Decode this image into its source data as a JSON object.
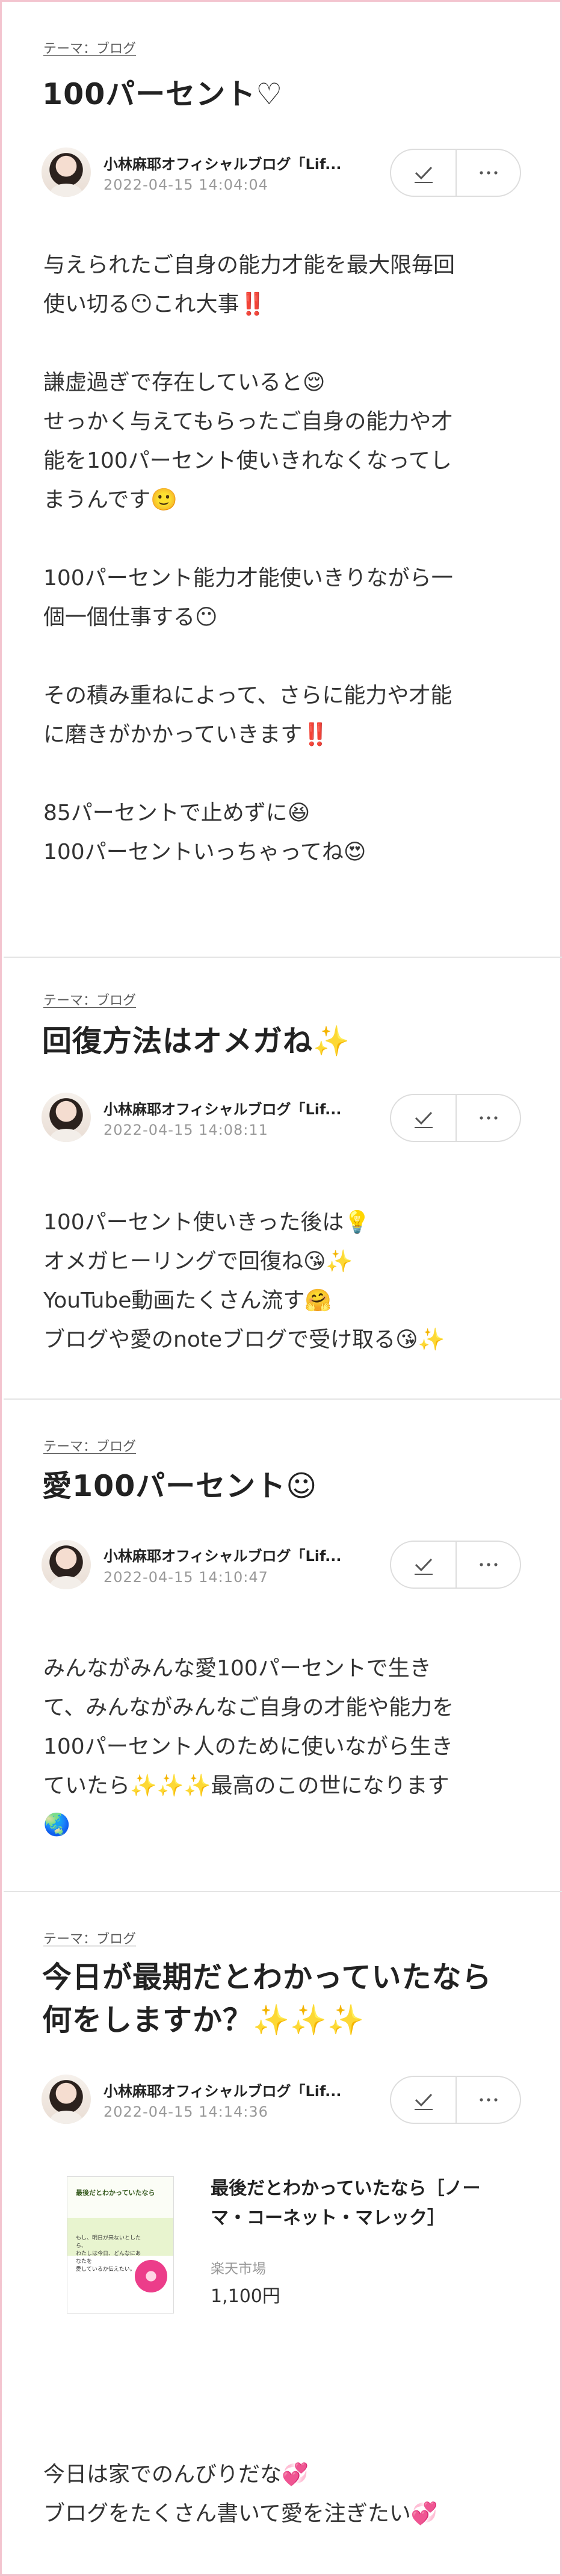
{
  "posts": [
    {
      "theme": "テーマ：ブログ",
      "title": "100パーセント♡",
      "author": "小林麻耶オフィシャルブログ「Lif...",
      "date": "2022-04-15 14:04:04",
      "paragraphs": [
        "与えられたご自身の能力才能を最大限毎回\n使い切る😶これ大事‼️",
        "謙虚過ぎで存在していると😌\nせっかく与えてもらったご自身の能力や才\n能を100パーセント使いきれなくなってし\nまうんです🙂",
        "100パーセント能力才能使いきりながら一\n個一個仕事する😶",
        "その積み重ねによって、さらに能力や才能\nに磨きがかかっていきます‼️",
        "85パーセントで止めずに😆\n100パーセントいっちゃってね😍"
      ]
    },
    {
      "theme": "テーマ：ブログ",
      "title": "回復方法はオメガね✨",
      "author": "小林麻耶オフィシャルブログ「Lif...",
      "date": "2022-04-15 14:08:11",
      "paragraphs": [
        "100パーセント使いきった後は💡\nオメガヒーリングで回復ね😘✨\nYouTube動画たくさん流す🤗\nブログや愛のnoteブログで受け取る😘✨"
      ]
    },
    {
      "theme": "テーマ：ブログ",
      "title": "愛100パーセント☺︎",
      "author": "小林麻耶オフィシャルブログ「Lif...",
      "date": "2022-04-15 14:10:47",
      "paragraphs": [
        "みんながみんな愛100パーセントで生き\nて、みんながみんなご自身の才能や能力を\n100パーセント人のために使いながら生き\nていたら✨✨✨最高のこの世になります\n🌏"
      ]
    },
    {
      "theme": "テーマ：ブログ",
      "title": "今日が最期だとわかっていたなら何をしますか？✨✨✨",
      "author": "小林麻耶オフィシャルブログ「Lif...",
      "date": "2022-04-15 14:14:36",
      "card": {
        "book_title": "最後だとわかっていたなら",
        "book_lines": "もし、明日が来ないとしたら、\nわたしは今日、どんなにあなたを\n愛しているか伝えたい。",
        "title": "最後だとわかっていたなら［ノーマ・コーネット・マレック］",
        "shop": "楽天市場",
        "price": "1,100円"
      },
      "paragraphs": [
        "今日は家でのんびりだな💞\nブログをたくさん書いて愛を注ぎたい💞"
      ]
    }
  ],
  "icons": {
    "like": "check-icon",
    "menu": "more-dots-icon"
  },
  "colors": {
    "frame": "#f3c4cf",
    "divider": "#e4e4e4",
    "muted": "#999999"
  }
}
